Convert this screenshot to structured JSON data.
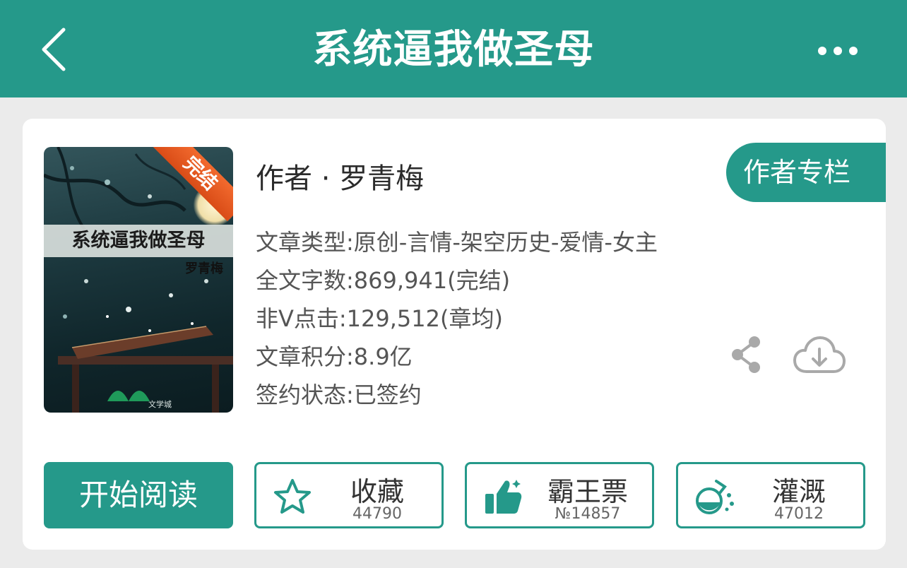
{
  "nav": {
    "title": "系统逼我做圣母"
  },
  "cover": {
    "title": "系统逼我做圣母",
    "author": "罗青梅",
    "ribbon": "完结",
    "logo": "文学城"
  },
  "book": {
    "author_line": "作者 · 罗青梅",
    "author_column": "作者专栏",
    "info": [
      "文章类型:原创-言情-架空历史-爱情-女主",
      "全文字数:869,941(完结)",
      "非Ⅴ点击:129,512(章均)",
      "文章积分:8.9亿",
      "签约状态:已签约"
    ]
  },
  "actions": {
    "read_label": "开始阅读",
    "favorite": {
      "label": "收藏",
      "count": "44790"
    },
    "vote": {
      "label": "霸王票",
      "count": "№14857"
    },
    "nutrient": {
      "label": "灌溉",
      "count": "47012"
    }
  },
  "icons": {
    "back": "chevron-left-icon",
    "more": "more-horizontal-icon",
    "share": "share-icon",
    "download": "cloud-download-icon",
    "favorite": "star-icon",
    "vote": "thumbs-up-icon",
    "nutrient": "flask-icon"
  },
  "colors": {
    "accent": "#25998a",
    "ribbon": "#e4581f",
    "background": "#ebebeb"
  }
}
